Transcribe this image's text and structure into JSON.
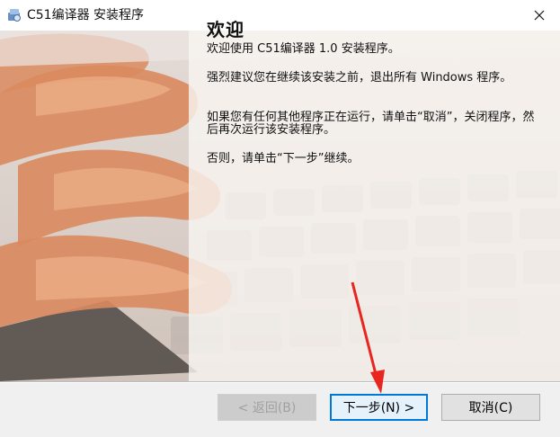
{
  "window": {
    "title": "C51编译器 安装程序",
    "icon": "installer-app-icon",
    "close_icon": "close-icon"
  },
  "main": {
    "heading": "欢迎",
    "paragraphs": [
      "欢迎使用 C51编译器 1.0 安装程序。",
      "强烈建议您在继续该安装之前，退出所有 Windows 程序。",
      "如果您有任何其他程序正在运行，请单击“取消”，关闭程序，然后再次运行该安装程序。",
      "否则，请单击“下一步”继续。"
    ]
  },
  "buttons": {
    "back": "< 返回(B)",
    "next": "下一步(N) >",
    "cancel": "取消(C)"
  },
  "colors": {
    "accent": "#0078d7",
    "annotation": "#e8261f"
  }
}
